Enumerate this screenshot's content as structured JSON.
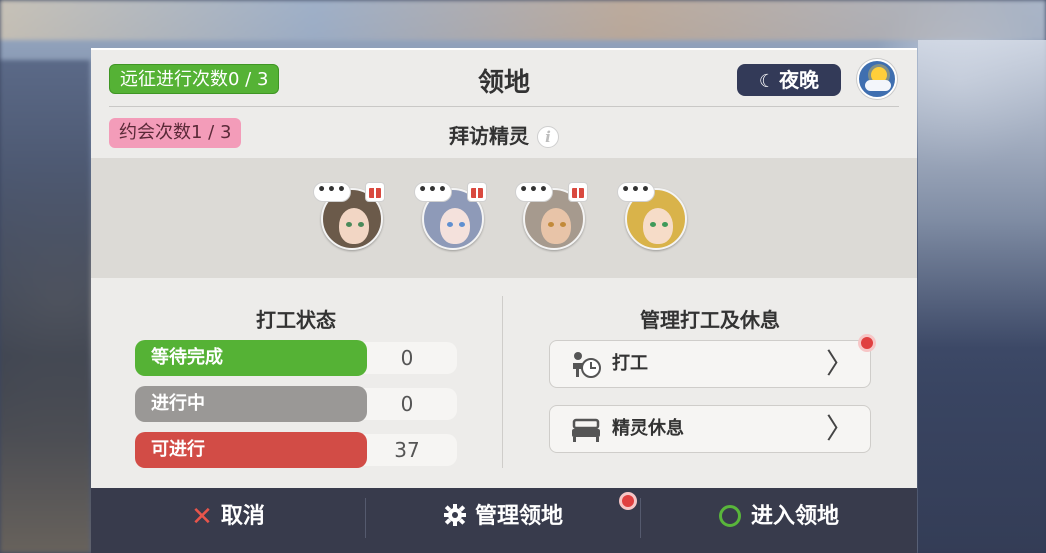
{
  "header": {
    "expedition_label": "远征进行次数0 / 3",
    "date_label": "约会次数1 / 3",
    "title": "领地",
    "time_of_day": "夜晚",
    "weather_icon": "sun-cloud-icon"
  },
  "visit": {
    "title": "拜访精灵",
    "info_icon": "i",
    "spirits": [
      {
        "bubble": "•••",
        "gift": true
      },
      {
        "bubble": "•••",
        "gift": true
      },
      {
        "bubble": "•••",
        "gift": true
      },
      {
        "bubble": "•••",
        "gift": false
      }
    ]
  },
  "work_status": {
    "title": "打工状态",
    "rows": [
      {
        "label": "等待完成",
        "value": "0",
        "color": "#55b235"
      },
      {
        "label": "进行中",
        "value": "0",
        "color": "#9a9896"
      },
      {
        "label": "可进行",
        "value": "37",
        "color": "#d24c46"
      }
    ]
  },
  "manage": {
    "title": "管理打工及休息",
    "work_label": "打工",
    "rest_label": "精灵休息",
    "chevron": "〉"
  },
  "footer": {
    "cancel_label": "取消",
    "manage_label": "管理领地",
    "enter_label": "进入领地"
  },
  "colors": {
    "accent_green": "#55b235",
    "accent_pink": "#f39cb9",
    "accent_red": "#d24c46",
    "footer_bg": "#383b4c"
  }
}
